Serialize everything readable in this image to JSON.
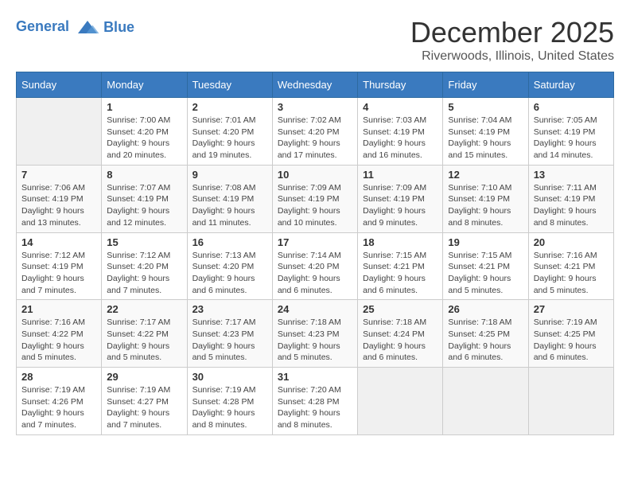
{
  "logo": {
    "line1": "General",
    "line2": "Blue"
  },
  "title": "December 2025",
  "subtitle": "Riverwoods, Illinois, United States",
  "weekdays": [
    "Sunday",
    "Monday",
    "Tuesday",
    "Wednesday",
    "Thursday",
    "Friday",
    "Saturday"
  ],
  "weeks": [
    [
      {
        "day": "",
        "info": ""
      },
      {
        "day": "1",
        "info": "Sunrise: 7:00 AM\nSunset: 4:20 PM\nDaylight: 9 hours\nand 20 minutes."
      },
      {
        "day": "2",
        "info": "Sunrise: 7:01 AM\nSunset: 4:20 PM\nDaylight: 9 hours\nand 19 minutes."
      },
      {
        "day": "3",
        "info": "Sunrise: 7:02 AM\nSunset: 4:20 PM\nDaylight: 9 hours\nand 17 minutes."
      },
      {
        "day": "4",
        "info": "Sunrise: 7:03 AM\nSunset: 4:19 PM\nDaylight: 9 hours\nand 16 minutes."
      },
      {
        "day": "5",
        "info": "Sunrise: 7:04 AM\nSunset: 4:19 PM\nDaylight: 9 hours\nand 15 minutes."
      },
      {
        "day": "6",
        "info": "Sunrise: 7:05 AM\nSunset: 4:19 PM\nDaylight: 9 hours\nand 14 minutes."
      }
    ],
    [
      {
        "day": "7",
        "info": "Sunrise: 7:06 AM\nSunset: 4:19 PM\nDaylight: 9 hours\nand 13 minutes."
      },
      {
        "day": "8",
        "info": "Sunrise: 7:07 AM\nSunset: 4:19 PM\nDaylight: 9 hours\nand 12 minutes."
      },
      {
        "day": "9",
        "info": "Sunrise: 7:08 AM\nSunset: 4:19 PM\nDaylight: 9 hours\nand 11 minutes."
      },
      {
        "day": "10",
        "info": "Sunrise: 7:09 AM\nSunset: 4:19 PM\nDaylight: 9 hours\nand 10 minutes."
      },
      {
        "day": "11",
        "info": "Sunrise: 7:09 AM\nSunset: 4:19 PM\nDaylight: 9 hours\nand 9 minutes."
      },
      {
        "day": "12",
        "info": "Sunrise: 7:10 AM\nSunset: 4:19 PM\nDaylight: 9 hours\nand 8 minutes."
      },
      {
        "day": "13",
        "info": "Sunrise: 7:11 AM\nSunset: 4:19 PM\nDaylight: 9 hours\nand 8 minutes."
      }
    ],
    [
      {
        "day": "14",
        "info": "Sunrise: 7:12 AM\nSunset: 4:19 PM\nDaylight: 9 hours\nand 7 minutes."
      },
      {
        "day": "15",
        "info": "Sunrise: 7:12 AM\nSunset: 4:20 PM\nDaylight: 9 hours\nand 7 minutes."
      },
      {
        "day": "16",
        "info": "Sunrise: 7:13 AM\nSunset: 4:20 PM\nDaylight: 9 hours\nand 6 minutes."
      },
      {
        "day": "17",
        "info": "Sunrise: 7:14 AM\nSunset: 4:20 PM\nDaylight: 9 hours\nand 6 minutes."
      },
      {
        "day": "18",
        "info": "Sunrise: 7:15 AM\nSunset: 4:21 PM\nDaylight: 9 hours\nand 6 minutes."
      },
      {
        "day": "19",
        "info": "Sunrise: 7:15 AM\nSunset: 4:21 PM\nDaylight: 9 hours\nand 5 minutes."
      },
      {
        "day": "20",
        "info": "Sunrise: 7:16 AM\nSunset: 4:21 PM\nDaylight: 9 hours\nand 5 minutes."
      }
    ],
    [
      {
        "day": "21",
        "info": "Sunrise: 7:16 AM\nSunset: 4:22 PM\nDaylight: 9 hours\nand 5 minutes."
      },
      {
        "day": "22",
        "info": "Sunrise: 7:17 AM\nSunset: 4:22 PM\nDaylight: 9 hours\nand 5 minutes."
      },
      {
        "day": "23",
        "info": "Sunrise: 7:17 AM\nSunset: 4:23 PM\nDaylight: 9 hours\nand 5 minutes."
      },
      {
        "day": "24",
        "info": "Sunrise: 7:18 AM\nSunset: 4:23 PM\nDaylight: 9 hours\nand 5 minutes."
      },
      {
        "day": "25",
        "info": "Sunrise: 7:18 AM\nSunset: 4:24 PM\nDaylight: 9 hours\nand 6 minutes."
      },
      {
        "day": "26",
        "info": "Sunrise: 7:18 AM\nSunset: 4:25 PM\nDaylight: 9 hours\nand 6 minutes."
      },
      {
        "day": "27",
        "info": "Sunrise: 7:19 AM\nSunset: 4:25 PM\nDaylight: 9 hours\nand 6 minutes."
      }
    ],
    [
      {
        "day": "28",
        "info": "Sunrise: 7:19 AM\nSunset: 4:26 PM\nDaylight: 9 hours\nand 7 minutes."
      },
      {
        "day": "29",
        "info": "Sunrise: 7:19 AM\nSunset: 4:27 PM\nDaylight: 9 hours\nand 7 minutes."
      },
      {
        "day": "30",
        "info": "Sunrise: 7:19 AM\nSunset: 4:28 PM\nDaylight: 9 hours\nand 8 minutes."
      },
      {
        "day": "31",
        "info": "Sunrise: 7:20 AM\nSunset: 4:28 PM\nDaylight: 9 hours\nand 8 minutes."
      },
      {
        "day": "",
        "info": ""
      },
      {
        "day": "",
        "info": ""
      },
      {
        "day": "",
        "info": ""
      }
    ]
  ]
}
